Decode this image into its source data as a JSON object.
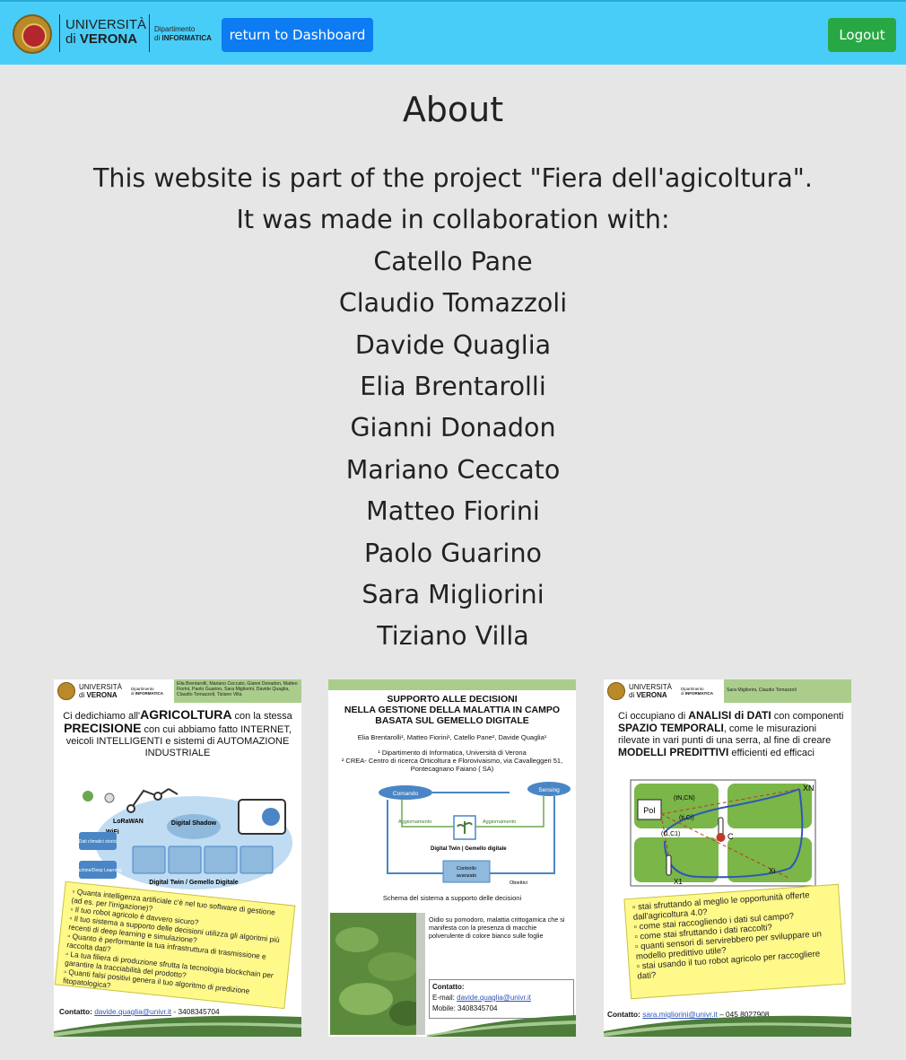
{
  "nav": {
    "logo": {
      "university_line1": "UNIVERSITÀ",
      "university_line2_prefix": "di",
      "university_line2": "VERONA",
      "department_line1": "Dipartimento",
      "department_line2_prefix": "di",
      "department_line2": "INFORMATICA"
    },
    "dashboard_button": "return to Dashboard",
    "logout_button": "Logout",
    "colors": {
      "bar": "#48cdf8",
      "dashboard_button": "#0d7cf2",
      "logout_button": "#27a844"
    }
  },
  "about": {
    "title": "About",
    "intro_line1": "This website is part of the project \"Fiera dell'agicoltura\".",
    "intro_line2": "It was made in collaboration with:",
    "collaborators": [
      "Catello Pane",
      "Claudio Tomazzoli",
      "Davide Quaglia",
      "Elia Brentarolli",
      "Gianni Donadon",
      "Mariano Ceccato",
      "Matteo Fiorini",
      "Paolo Guarino",
      "Sara Migliorini",
      "Tiziano Villa"
    ]
  },
  "posters": {
    "p1": {
      "authors": "Elia Brentarolli, Mariano Ceccato, Gianni Donadon, Matteo Fiorini, Paolo Guarino, Sara Migliorini, Davide Quaglia, Claudio Tomazzoli, Tiziano Villa",
      "lead_pre": "Ci dedichiamo all'",
      "lead_b1": "AGRICOLTURA",
      "lead_mid1": " con la stessa ",
      "lead_b2": "PRECISIONE",
      "lead_mid2": " con cui abbiamo fatto INTERNET, veicoli INTELLIGENTI e sistemi di AUTOMAZIONE INDUSTRIALE",
      "diagram_labels": {
        "lorawan": "LoRaWAN",
        "wifi": "WiFi",
        "shadow": "Digital Shadow",
        "dati": "Dati climatici storici",
        "ml": "Machine/Deep Learning",
        "twin": "Digital Twin / Gemello Digitale"
      },
      "questions": [
        "Quanta intelligenza artificiale c'è nel tuo software di gestione (ad es. per l'irrigazione)?",
        "Il tuo robot agricolo è davvero sicuro?",
        "Il tuo sistema a supporto delle decisioni utilizza gli algoritmi più recenti di deep learning e simulazione?",
        "Quanto è performante la tua infrastruttura di trasmissione e raccolta dati?",
        "La tua filiera di produzione sfrutta la tecnologia blockchain per garantire la tracciabilità del prodotto?",
        "Quanti falsi positivi genera il tuo algoritmo di predizione fitopatologica?"
      ],
      "contact_label": "Contatto:",
      "contact_email": "davide.quaglia@univr.it",
      "contact_phone": "- 3408345704"
    },
    "p2": {
      "title_line1": "SUPPORTO ALLE DECISIONI",
      "title_line2": "NELLA GESTIONE DELLA MALATTIA IN CAMPO",
      "title_line3": "BASATA SUL GEMELLO DIGITALE",
      "authors": "Elia Brentarolli¹, Matteo Fiorini¹, Catello Pane², Davide Quaglia¹",
      "affiliation1": "¹ Dipartimento di Informatica, Università di Verona",
      "affiliation2": "² CREA- Centro di ricerca Orticoltura e Florovivaismo,  via Cavalleggeri 51,",
      "affiliation3": "Pontecagnano Faiano ( SA)",
      "diagram_labels": {
        "comando": "Comando",
        "sensing": "Sensing",
        "agg_left": "Aggiornamento",
        "agg_right": "Aggiornamento",
        "twin": "Digital Twin | Gemello digitale",
        "controllo1": "Controllo",
        "controllo2": "avanzato",
        "obiettivi": "Obiettivi"
      },
      "caption": "Schema del sistema a supporto delle decisioni",
      "photo_text": "Oidio su pomodoro,  malattia crittogamica che si manifesta con la presenza di macchie polverulente di colore bianco sulle foglie",
      "contact_label": "Contatto:",
      "email_label": "E-mail:",
      "contact_email": "davide.quaglia@univr.it",
      "mobile": "Mobile: 3408345704"
    },
    "p3": {
      "authors": "Sara Migliorini, Claudio Tomazzoli",
      "lead_pre": "Ci occupiano di ",
      "lead_b1": "ANALISI di DATI",
      "lead_mid1": " con componenti ",
      "lead_b2": "SPAZIO TEMPORALI",
      "lead_mid2": ", come le misurazioni rilevate in vari punti di una serra, al fine di creare ",
      "lead_b3": "MODELLI PREDITTIVI",
      "lead_end": " efficienti ed efficaci",
      "diagram_labels": {
        "poi": "PoI",
        "xn": "XN",
        "c": "C",
        "tncn": "(tN,CN)",
        "tici": "(ti,Ci)",
        "t1c1": "(t1,C1)",
        "x1": "X1",
        "xi": "Xi"
      },
      "questions": [
        "stai sfruttando al meglio le opportunità offerte dall'agricoltura 4.0?",
        "come stai raccogliendo i dati sul campo?",
        "come stai sfruttando i dati raccolti?",
        "quanti sensori di servirebbero per sviluppare un modello predittivo utile?",
        "stai usando il tuo robot agricolo per raccogliere dati?"
      ],
      "contact_label": "Contatto:",
      "contact_email": "sara.migliorini@univr.it",
      "contact_phone": "– 045 8027908"
    }
  }
}
